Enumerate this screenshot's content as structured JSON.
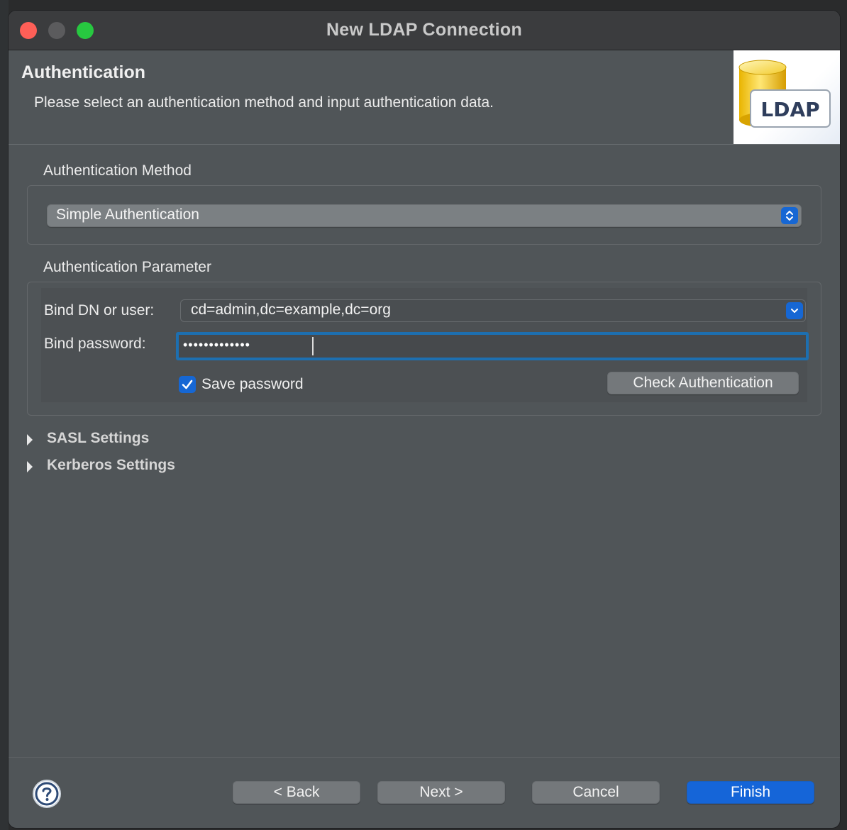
{
  "window": {
    "title": "New LDAP Connection"
  },
  "header": {
    "title": "Authentication",
    "description": "Please select an authentication method and input authentication data.",
    "logo_text": "LDAP"
  },
  "auth_method": {
    "group_label": "Authentication Method",
    "selected": "Simple Authentication"
  },
  "auth_param": {
    "group_label": "Authentication Parameter",
    "bind_dn_label": "Bind DN or user:",
    "bind_dn_value": "cd=admin,dc=example,dc=org",
    "bind_password_label": "Bind password:",
    "bind_password_value": "•••••••••••••",
    "save_password_label": "Save password",
    "save_password_checked": true,
    "check_auth_button": "Check Authentication"
  },
  "expanders": [
    {
      "label": "SASL Settings",
      "expanded": false
    },
    {
      "label": "Kerberos Settings",
      "expanded": false
    }
  ],
  "footer": {
    "help_icon": "help-icon",
    "back": "< Back",
    "next": "Next >",
    "cancel": "Cancel",
    "finish": "Finish"
  },
  "colors": {
    "window_bg": "#505558",
    "titlebar_bg": "#3b3c3e",
    "accent": "#1565d8",
    "focus_ring": "#1d6fb0",
    "close": "#fe5f57",
    "maximize": "#27c840"
  }
}
